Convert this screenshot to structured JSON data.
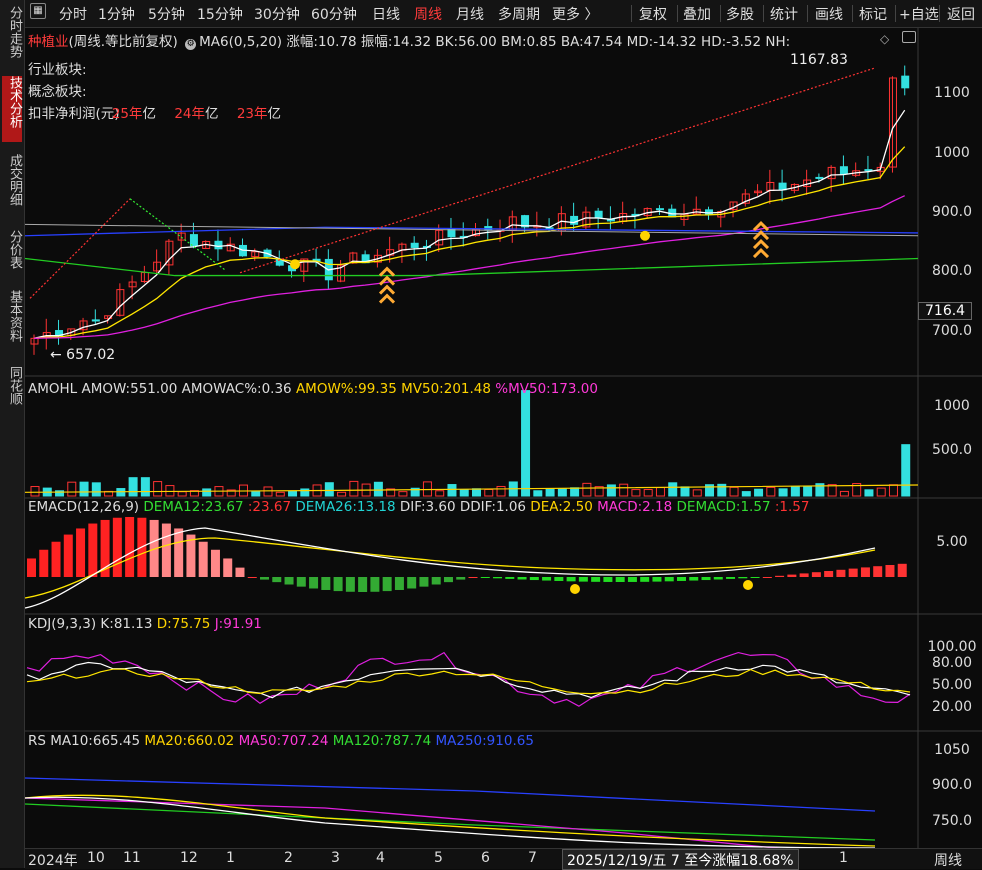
{
  "left_tabs": [
    {
      "label": "分时走势",
      "active": false
    },
    {
      "label": "技术分析",
      "active": true
    },
    {
      "label": "成交明细",
      "active": false
    },
    {
      "label": "分价表",
      "active": false
    },
    {
      "label": "基本资料",
      "active": false
    },
    {
      "label": "同花顺",
      "active": false
    }
  ],
  "toolbar": {
    "left_items": [
      "分时",
      "1分钟",
      "5分钟",
      "15分钟",
      "30分钟",
      "60分钟",
      "日线",
      "周线",
      "月线",
      "多周期",
      "更多 〉"
    ],
    "active_item": "周线",
    "right_items": [
      "复权",
      "叠加",
      "多股",
      "统计",
      "画线",
      "标记",
      "+自选",
      "返回"
    ]
  },
  "main_panel": {
    "stock_name": "种植业",
    "mode": "(周线.等比前复权)",
    "ma_label": "MA6(0,5,20)",
    "stats": [
      {
        "label": "涨幅:",
        "value": "10.78"
      },
      {
        "label": "振幅:",
        "value": "14.32"
      },
      {
        "label": "BK:",
        "value": "56.00"
      },
      {
        "label": "BM:",
        "value": "0.85"
      },
      {
        "label": "BA:",
        "value": "47.54"
      },
      {
        "label": "MD:",
        "value": "-14.32"
      },
      {
        "label": "HD:",
        "value": "-3.52"
      },
      {
        "label": "NH:",
        "value": ""
      }
    ],
    "overlay_lines": [
      "行业板块:",
      "概念板块:"
    ],
    "profit_label": "扣非净利润(元)",
    "profit_items": [
      {
        "year": "25年",
        "unit": "亿"
      },
      {
        "year": "24年",
        "unit": "亿"
      },
      {
        "year": "23年",
        "unit": "亿"
      }
    ],
    "high_label": "1167.83",
    "low_label": "← 657.02",
    "current_price_box": "716.4",
    "y_ticks": [
      "1100",
      "1000",
      "900.0",
      "800.0",
      "700.0"
    ]
  },
  "amo_panel": {
    "title": "AMOHL",
    "stats": [
      {
        "label": "AMOW:",
        "value": "551.00",
        "color": "#e0e0e0"
      },
      {
        "label": "AMOWAC%:",
        "value": "0.36",
        "color": "#e0e0e0"
      },
      {
        "label": "AMOW%:",
        "value": "99.35",
        "color": "#ffd400"
      },
      {
        "label": "MV50:",
        "value": "201.48",
        "color": "#ffd400"
      },
      {
        "label": "%MV50:",
        "value": "173.00",
        "color": "#ff3ad8"
      }
    ],
    "y_ticks": [
      "1000",
      "500.0"
    ]
  },
  "macd_panel": {
    "title": "EMACD(12,26,9)",
    "stats": [
      {
        "label": "DEMA12:",
        "value": "23.67",
        "color": "#33dd33"
      },
      {
        "label": ":",
        "value": "23.67",
        "color": "#ff3333"
      },
      {
        "label": "DEMA26:",
        "value": "13.18",
        "color": "#22d4d4"
      },
      {
        "label": "DIF:",
        "value": "3.60",
        "color": "#e0e0e0"
      },
      {
        "label": "DDIF:",
        "value": "1.06",
        "color": "#e0e0e0"
      },
      {
        "label": "DEA:",
        "value": "2.50",
        "color": "#ffd400"
      },
      {
        "label": "MACD:",
        "value": "2.18",
        "color": "#ff3ad8"
      },
      {
        "label": "DEMACD:",
        "value": "1.57",
        "color": "#33dd33"
      },
      {
        "label": ":",
        "value": "1.57",
        "color": "#ff3333"
      }
    ],
    "y_ticks": [
      "5.00"
    ]
  },
  "kdj_panel": {
    "title": "KDJ(9,3,3)",
    "stats": [
      {
        "label": "K:",
        "value": "81.13",
        "color": "#e0e0e0"
      },
      {
        "label": "D:",
        "value": "75.75",
        "color": "#ffd400"
      },
      {
        "label": "J:",
        "value": "91.91",
        "color": "#ff3ad8"
      }
    ],
    "y_ticks": [
      "100.00",
      "80.00",
      "50.00",
      "20.00"
    ]
  },
  "rs_panel": {
    "title": "RS",
    "stats": [
      {
        "label": "MA10:",
        "value": "665.45",
        "color": "#e0e0e0"
      },
      {
        "label": "MA20:",
        "value": "660.02",
        "color": "#ffd400"
      },
      {
        "label": "MA50:",
        "value": "707.24",
        "color": "#ff3ad8"
      },
      {
        "label": "MA120:",
        "value": "787.74",
        "color": "#33dd33"
      },
      {
        "label": "MA250:",
        "value": "910.65",
        "color": "#3355ff"
      }
    ],
    "y_ticks": [
      "1050",
      "900.0",
      "750.0"
    ]
  },
  "date_axis": {
    "labels": [
      "2024年",
      "10",
      "11",
      "12",
      "1",
      "2",
      "3",
      "4",
      "5",
      "6",
      "7"
    ],
    "right_labels": [
      "1"
    ],
    "cursor_tip": "2025/12/19/五 7 至今涨幅18.68%",
    "period": "周线"
  },
  "colors": {
    "up": "#ff3333",
    "down": "#33e0e0",
    "ma_white": "#ffffff",
    "ma_yellow": "#ffe600",
    "ma_magenta": "#e020e0",
    "ma_green": "#22cc22",
    "ma_blue": "#2840ff"
  }
}
